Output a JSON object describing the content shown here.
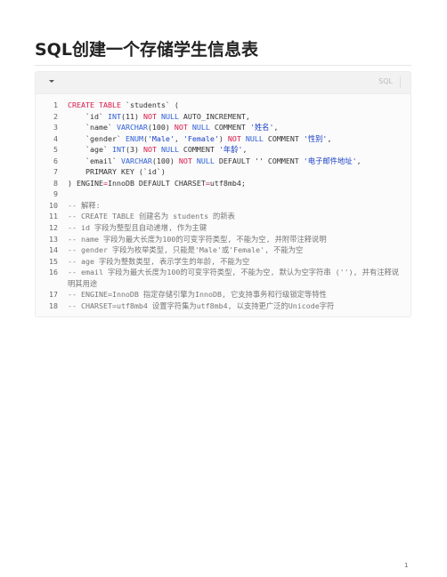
{
  "document": {
    "title": "SQL创建一个存储学生信息表",
    "page_number": "1"
  },
  "code_block": {
    "language": "SQL",
    "collapse_icon": "caret-down-icon",
    "lines": [
      {
        "n": "1",
        "tokens": [
          {
            "t": "CREATE TABLE",
            "c": "kw"
          },
          {
            "t": " `students` (",
            "c": ""
          }
        ]
      },
      {
        "n": "2",
        "tokens": [
          {
            "t": "    `id` ",
            "c": ""
          },
          {
            "t": "INT",
            "c": "ty"
          },
          {
            "t": "(11) ",
            "c": ""
          },
          {
            "t": "NOT",
            "c": "kw"
          },
          {
            "t": " ",
            "c": ""
          },
          {
            "t": "NULL",
            "c": "ty"
          },
          {
            "t": " AUTO_INCREMENT,",
            "c": ""
          }
        ]
      },
      {
        "n": "3",
        "tokens": [
          {
            "t": "    `name` ",
            "c": ""
          },
          {
            "t": "VARCHAR",
            "c": "ty"
          },
          {
            "t": "(100) ",
            "c": ""
          },
          {
            "t": "NOT",
            "c": "kw"
          },
          {
            "t": " ",
            "c": ""
          },
          {
            "t": "NULL",
            "c": "ty"
          },
          {
            "t": " COMMENT ",
            "c": ""
          },
          {
            "t": "'姓名'",
            "c": "st"
          },
          {
            "t": ",",
            "c": ""
          }
        ]
      },
      {
        "n": "4",
        "tokens": [
          {
            "t": "    `gender` ",
            "c": ""
          },
          {
            "t": "ENUM",
            "c": "ty"
          },
          {
            "t": "(",
            "c": ""
          },
          {
            "t": "'Male'",
            "c": "st"
          },
          {
            "t": ", ",
            "c": ""
          },
          {
            "t": "'Female'",
            "c": "st"
          },
          {
            "t": ") ",
            "c": ""
          },
          {
            "t": "NOT",
            "c": "kw"
          },
          {
            "t": " ",
            "c": ""
          },
          {
            "t": "NULL",
            "c": "ty"
          },
          {
            "t": " COMMENT ",
            "c": ""
          },
          {
            "t": "'性别'",
            "c": "st"
          },
          {
            "t": ",",
            "c": ""
          }
        ]
      },
      {
        "n": "5",
        "tokens": [
          {
            "t": "    `age` ",
            "c": ""
          },
          {
            "t": "INT",
            "c": "ty"
          },
          {
            "t": "(3) ",
            "c": ""
          },
          {
            "t": "NOT",
            "c": "kw"
          },
          {
            "t": " ",
            "c": ""
          },
          {
            "t": "NULL",
            "c": "ty"
          },
          {
            "t": " COMMENT ",
            "c": ""
          },
          {
            "t": "'年龄'",
            "c": "st"
          },
          {
            "t": ",",
            "c": ""
          }
        ]
      },
      {
        "n": "6",
        "tokens": [
          {
            "t": "    `email` ",
            "c": ""
          },
          {
            "t": "VARCHAR",
            "c": "ty"
          },
          {
            "t": "(100) ",
            "c": ""
          },
          {
            "t": "NOT",
            "c": "kw"
          },
          {
            "t": " ",
            "c": ""
          },
          {
            "t": "NULL",
            "c": "ty"
          },
          {
            "t": " DEFAULT '' COMMENT ",
            "c": ""
          },
          {
            "t": "'电子邮件地址'",
            "c": "st"
          },
          {
            "t": ",",
            "c": ""
          }
        ]
      },
      {
        "n": "7",
        "tokens": [
          {
            "t": "    PRIMARY KEY (`id`)",
            "c": ""
          }
        ]
      },
      {
        "n": "8",
        "tokens": [
          {
            "t": ") ENGINE",
            "c": ""
          },
          {
            "t": "=",
            "c": "op"
          },
          {
            "t": "InnoDB DEFAULT CHARSET",
            "c": ""
          },
          {
            "t": "=",
            "c": "op"
          },
          {
            "t": "utf8mb4;",
            "c": ""
          }
        ]
      },
      {
        "n": "9",
        "tokens": [
          {
            "t": "",
            "c": ""
          }
        ]
      },
      {
        "n": "10",
        "tokens": [
          {
            "t": "-- 解释:",
            "c": "cm"
          }
        ]
      },
      {
        "n": "11",
        "tokens": [
          {
            "t": "-- CREATE TABLE 创建名为 students 的新表",
            "c": "cm"
          }
        ]
      },
      {
        "n": "12",
        "tokens": [
          {
            "t": "-- id 字段为整型且自动递增, 作为主键",
            "c": "cm"
          }
        ]
      },
      {
        "n": "13",
        "tokens": [
          {
            "t": "-- name 字段为最大长度为100的可变字符类型, 不能为空, 并附带注释说明",
            "c": "cm"
          }
        ]
      },
      {
        "n": "14",
        "tokens": [
          {
            "t": "-- gender 字段为枚举类型, 只能是'Male'或'Female', 不能为空",
            "c": "cm"
          }
        ]
      },
      {
        "n": "15",
        "tokens": [
          {
            "t": "-- age 字段为整数类型, 表示学生的年龄, 不能为空",
            "c": "cm"
          }
        ]
      },
      {
        "n": "16",
        "tokens": [
          {
            "t": "-- email 字段为最大长度为100的可变字符类型, 不能为空, 默认为空字符串 (''), 并有注释说明其用途",
            "c": "cm"
          }
        ]
      },
      {
        "n": "17",
        "tokens": [
          {
            "t": "-- ENGINE=InnoDB 指定存储引擎为InnoDB, 它支持事务和行级锁定等特性",
            "c": "cm"
          }
        ]
      },
      {
        "n": "18",
        "tokens": [
          {
            "t": "-- CHARSET=utf8mb4 设置字符集为utf8mb4, 以支持更广泛的Unicode字符",
            "c": "cm"
          }
        ]
      }
    ]
  }
}
